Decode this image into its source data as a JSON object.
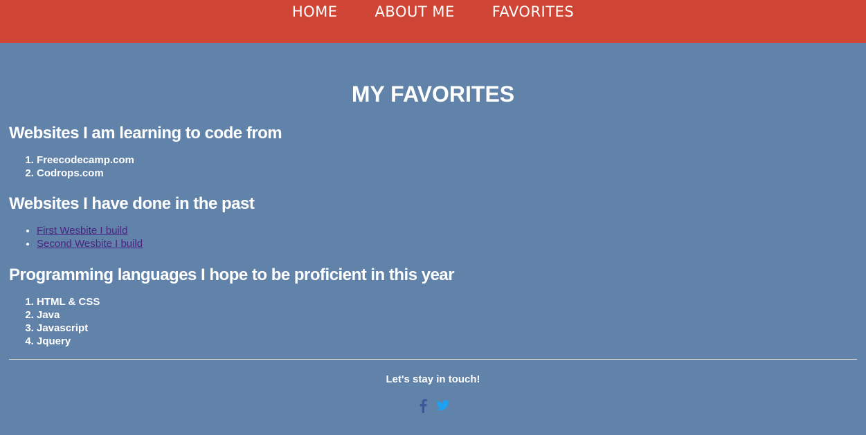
{
  "nav": {
    "items": [
      {
        "label": "HOME"
      },
      {
        "label": "ABOUT ME"
      },
      {
        "label": "FAVORITES"
      }
    ]
  },
  "main": {
    "title": "MY FAVORITES",
    "sections": [
      {
        "heading": "Websites I am learning to code from",
        "items": [
          "Freecodecamp.com",
          "Codrops.com"
        ]
      },
      {
        "heading": "Websites I have done in the past",
        "links": [
          "First Wesbite I build",
          "Second Wesbite I build"
        ]
      },
      {
        "heading": "Programming languages I hope to be proficient in this year",
        "items": [
          "HTML & CSS",
          "Java",
          "Javascript",
          "Jquery"
        ]
      }
    ]
  },
  "footer": {
    "text": "Let's stay in touch!",
    "icons": [
      "facebook-icon",
      "twitter-icon"
    ]
  },
  "colors": {
    "background": "#6183aa",
    "navbar": "#cf4535",
    "link": "#4b2382",
    "facebook": "#3b5998",
    "twitter": "#1da1f2"
  }
}
